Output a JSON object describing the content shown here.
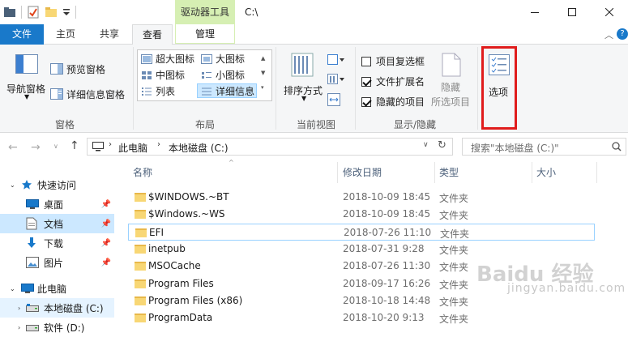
{
  "window": {
    "title": "C:\\",
    "contextual_tab_group": "驱动器工具"
  },
  "tabs": {
    "file": "文件",
    "home": "主页",
    "share": "共享",
    "view": "查看",
    "manage": "管理"
  },
  "ribbon": {
    "panes": {
      "navigation_pane": "导航窗格",
      "preview_pane": "预览窗格",
      "details_pane": "详细信息窗格",
      "group_label": "窗格"
    },
    "layout": {
      "extra_large_icons": "超大图标",
      "large_icons": "大图标",
      "medium_icons": "中图标",
      "small_icons": "小图标",
      "list": "列表",
      "details": "详细信息",
      "group_label": "布局"
    },
    "current_view": {
      "sort_by": "排序方式",
      "group_label": "当前视图"
    },
    "show_hide": {
      "item_checkboxes": "项目复选框",
      "file_extensions": "文件扩展名",
      "hidden_items": "隐藏的项目",
      "hide_selected_line1": "隐藏",
      "hide_selected_line2": "所选项目",
      "group_label": "显示/隐藏",
      "item_checkboxes_checked": false,
      "file_extensions_checked": true,
      "hidden_items_checked": true
    },
    "options": {
      "label": "选项"
    }
  },
  "address": {
    "crumbs": [
      "此电脑",
      "本地磁盘 (C:)"
    ],
    "search_placeholder": "搜索\"本地磁盘 (C:)\""
  },
  "nav_pane": {
    "items": [
      {
        "label": "快速访问",
        "icon": "star-icon"
      },
      {
        "label": "桌面",
        "icon": "desktop-icon"
      },
      {
        "label": "文档",
        "icon": "document-icon"
      },
      {
        "label": "下载",
        "icon": "download-icon"
      },
      {
        "label": "图片",
        "icon": "picture-icon"
      },
      {
        "label": "此电脑",
        "icon": "computer-icon"
      },
      {
        "label": "本地磁盘 (C:)",
        "icon": "drive-icon"
      },
      {
        "label": "软件 (D:)",
        "icon": "drive-icon"
      }
    ]
  },
  "file_list": {
    "columns": {
      "name": "名称",
      "date": "修改日期",
      "type": "类型",
      "size": "大小"
    },
    "rows": [
      {
        "name": "$WINDOWS.~BT",
        "date": "2018-10-09 18:45",
        "type": "文件夹"
      },
      {
        "name": "$Windows.~WS",
        "date": "2018-10-09 18:45",
        "type": "文件夹"
      },
      {
        "name": "EFI",
        "date": "2018-07-26 11:10",
        "type": "文件夹"
      },
      {
        "name": "inetpub",
        "date": "2018-07-31 9:28",
        "type": "文件夹"
      },
      {
        "name": "MSOCache",
        "date": "2018-07-26 11:30",
        "type": "文件夹"
      },
      {
        "name": "Program Files",
        "date": "2018-09-17 16:26",
        "type": "文件夹"
      },
      {
        "name": "Program Files (x86)",
        "date": "2018-10-18 14:48",
        "type": "文件夹"
      },
      {
        "name": "ProgramData",
        "date": "2018-10-20 9:13",
        "type": "文件夹"
      }
    ]
  },
  "watermark": {
    "text": "Baidu 经验",
    "subtext": "jingyan.baidu.com"
  },
  "colors": {
    "accent": "#1979ca",
    "selection": "#cce8ff",
    "contextual_tab": "#d6efb3",
    "highlight_frame": "#e01c1c",
    "folder": "#f8d775"
  }
}
